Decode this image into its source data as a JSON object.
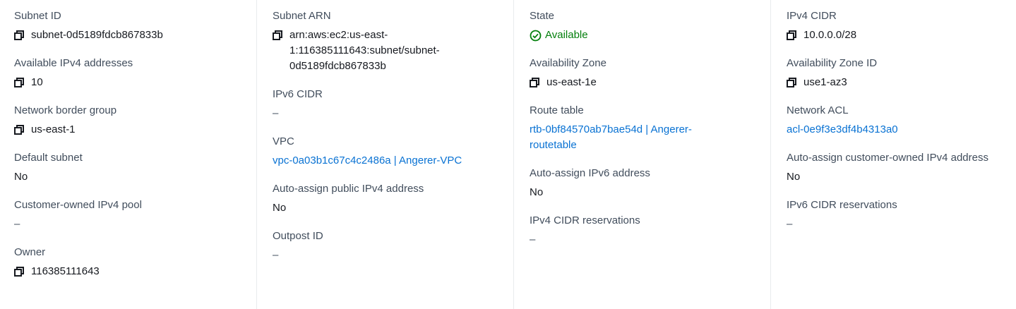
{
  "columns": [
    {
      "fields": [
        {
          "label": "Subnet ID",
          "value": "subnet-0d5189fdcb867833b"
        },
        {
          "label": "Available IPv4 addresses",
          "value": "10"
        },
        {
          "label": "Network border group",
          "value": "us-east-1"
        },
        {
          "label": "Default subnet",
          "value": "No"
        },
        {
          "label": "Customer-owned IPv4 pool",
          "value": "–"
        },
        {
          "label": "Owner",
          "value": "116385111643"
        }
      ]
    },
    {
      "fields": [
        {
          "label": "Subnet ARN",
          "value": "arn:aws:ec2:us-east-1:116385111643:subnet/subnet-0d5189fdcb867833b",
          "lines": [
            "arn:aws:ec2:us-east-",
            "1:116385111643:subnet/subnet-",
            "0d5189fdcb867833b"
          ]
        },
        {
          "label": "IPv6 CIDR",
          "value": "–"
        },
        {
          "label": "VPC",
          "value": "vpc-0a03b1c67c4c2486a | Angerer-VPC"
        },
        {
          "label": "Auto-assign public IPv4 address",
          "value": "No"
        },
        {
          "label": "Outpost ID",
          "value": "–"
        }
      ]
    },
    {
      "fields": [
        {
          "label": "State",
          "value": "Available"
        },
        {
          "label": "Availability Zone",
          "value": "us-east-1e"
        },
        {
          "label": "Route table",
          "value": "rtb-0bf84570ab7bae54d | Angerer-routetable",
          "lines": [
            "rtb-0bf84570ab7bae54d | Angerer-",
            "routetable"
          ]
        },
        {
          "label": "Auto-assign IPv6 address",
          "value": "No"
        },
        {
          "label": "IPv4 CIDR reservations",
          "value": "–"
        }
      ]
    },
    {
      "fields": [
        {
          "label": "IPv4 CIDR",
          "value": "10.0.0.0/28"
        },
        {
          "label": "Availability Zone ID",
          "value": "use1-az3"
        },
        {
          "label": "Network ACL",
          "value": "acl-0e9f3e3df4b4313a0"
        },
        {
          "label": "Auto-assign customer-owned IPv4 address",
          "value": "No"
        },
        {
          "label": "IPv6 CIDR reservations",
          "value": "–"
        }
      ]
    }
  ],
  "icons": {
    "copy": "copy-icon",
    "status": "check-circle-icon"
  },
  "colors": {
    "link": "#0972d3",
    "success": "#037f0c",
    "label": "#414d5c",
    "text": "#16191f"
  }
}
